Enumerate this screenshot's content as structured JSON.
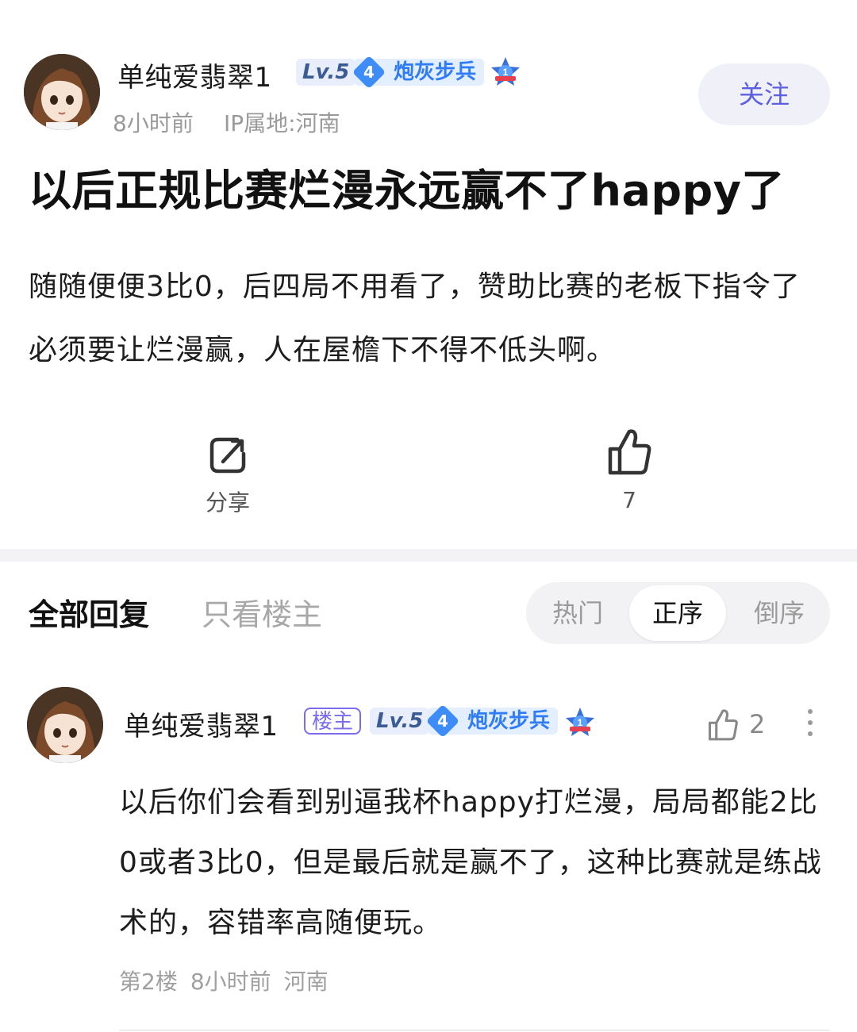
{
  "post": {
    "author": "单纯爱翡翠1",
    "level": "Lv.5",
    "rank_num": "4",
    "rank_title": "炮灰步兵",
    "time": "8小时前",
    "ip_location": "IP属地:河南",
    "follow_label": "关注",
    "title": "以后正规比赛烂漫永远赢不了happy了",
    "body": "随随便便3比0，后四局不用看了，赞助比赛的老板下指令了必须要让烂漫赢，人在屋檐下不得不低头啊。",
    "share_label": "分享",
    "like_count": "7"
  },
  "replies_header": {
    "tab_all": "全部回复",
    "tab_op_only": "只看楼主",
    "sort_options": [
      "热门",
      "正序",
      "倒序"
    ],
    "active_sort": "正序"
  },
  "replies": [
    {
      "author": "单纯爱翡翠1",
      "op_tag": "楼主",
      "level": "Lv.5",
      "rank_num": "4",
      "rank_title": "炮灰步兵",
      "like_count": "2",
      "body": "以后你们会看到别逼我杯happy打烂漫，局局都能2比0或者3比0，但是最后就是赢不了，这种比赛就是练战术的，容错率高随便玩。",
      "floor": "第2楼",
      "time": "8小时前",
      "location": "河南"
    }
  ],
  "icons": {
    "share": "share-icon",
    "like": "thumbs-up-icon",
    "more": "more-vertical-icon",
    "medal": "rank-medal-icon"
  },
  "colors": {
    "accent": "#5b5fe0",
    "rank_blue": "#2f7cf6",
    "op_tag": "#7a6cf0"
  }
}
